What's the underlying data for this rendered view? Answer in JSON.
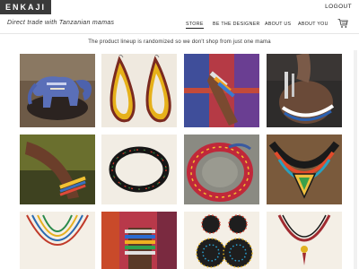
{
  "header": {
    "logo_text": "ENKAJI",
    "logout_label": "LOGOUT",
    "tagline": "Direct trade with Tanzanian mamas",
    "cart_icon": "cart-icon"
  },
  "nav": {
    "items": [
      {
        "label": "STORE",
        "active": true
      },
      {
        "label": "BE THE DESIGNER",
        "active": false
      },
      {
        "label": "ABOUT US",
        "active": false
      },
      {
        "label": "ABOUT YOU",
        "active": false
      }
    ]
  },
  "notice": "The product lineup is randomized so we don't shop from just one mama",
  "colors": {
    "logo_bg": "#3a3a3a",
    "text": "#222222"
  },
  "products": [
    {
      "name": "beaded-elephant"
    },
    {
      "name": "teardrop-earrings"
    },
    {
      "name": "beaded-arm-bangles"
    },
    {
      "name": "beaded-neck-collar"
    },
    {
      "name": "wrist-bracelet"
    },
    {
      "name": "black-bead-bracelet"
    },
    {
      "name": "red-bead-bangle"
    },
    {
      "name": "multicolor-necklace"
    },
    {
      "name": "strand-necklace"
    },
    {
      "name": "stacked-bangles"
    },
    {
      "name": "disc-earrings"
    },
    {
      "name": "pendant-necklace"
    }
  ]
}
